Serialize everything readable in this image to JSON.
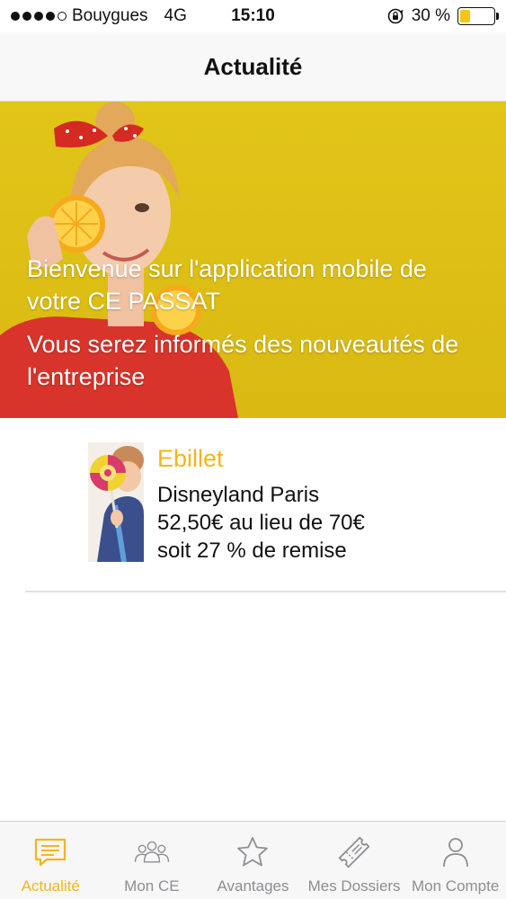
{
  "status_bar": {
    "carrier": "Bouygues",
    "network": "4G",
    "time": "15:10",
    "battery_text": "30 %",
    "battery_level": 0.3,
    "signal_bars_filled": 4,
    "signal_bars_total": 5,
    "icons": [
      "signal-dots-icon",
      "rotation-lock-icon",
      "battery-icon"
    ]
  },
  "nav": {
    "title": "Actualité"
  },
  "hero": {
    "title": "Bienvenue sur l'application mobile de votre CE PASSAT",
    "subtitle": "Vous serez informés des nouveautés de l'entreprise",
    "background_color": "#dcbd14"
  },
  "promo": {
    "category": "Ebillet",
    "line1": "Disneyland Paris",
    "line2": "52,50€ au lieu de 70€",
    "line3": "soit 27 % de remise",
    "accent_color": "#f2b51d"
  },
  "tabs": [
    {
      "label": "Actualité",
      "icon": "news-icon",
      "active": true
    },
    {
      "label": "Mon CE",
      "icon": "group-icon",
      "active": false
    },
    {
      "label": "Avantages",
      "icon": "star-icon",
      "active": false
    },
    {
      "label": "Mes Dossiers",
      "icon": "ticket-icon",
      "active": false
    },
    {
      "label": "Mon Compte",
      "icon": "user-icon",
      "active": false
    }
  ]
}
